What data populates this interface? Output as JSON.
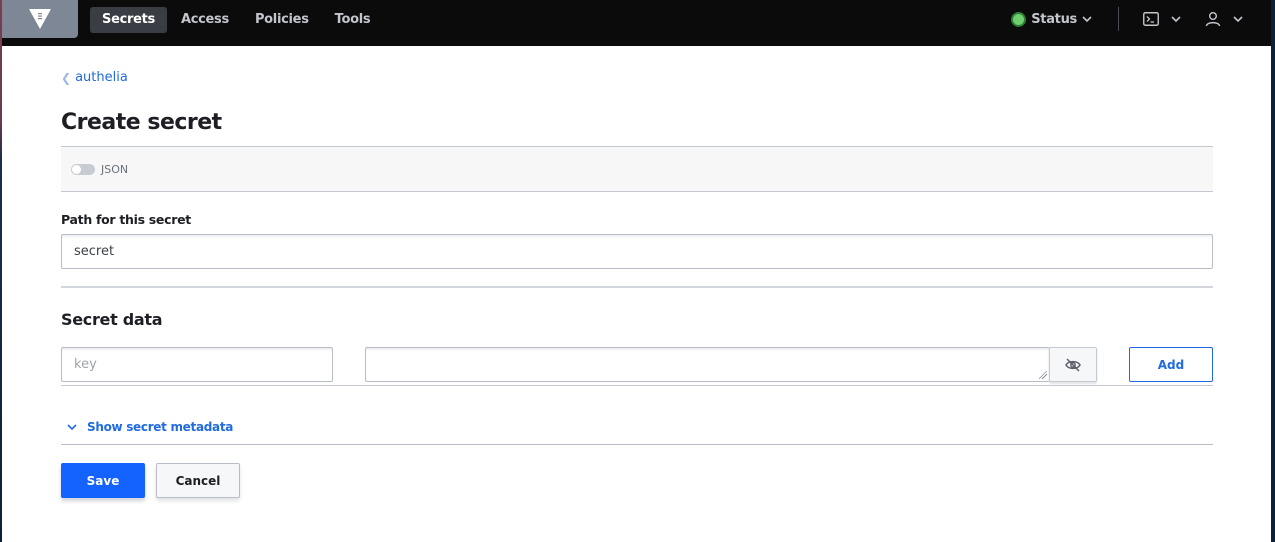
{
  "nav": {
    "logo_icon": "vault-logo-icon",
    "links": [
      {
        "label": "Secrets",
        "active": true
      },
      {
        "label": "Access",
        "active": false
      },
      {
        "label": "Policies",
        "active": false
      },
      {
        "label": "Tools",
        "active": false
      }
    ],
    "status_label": "Status",
    "status_color": "#6fcf6f",
    "console_icon": "terminal-icon",
    "user_icon": "user-icon"
  },
  "breadcrumb": {
    "label": "authelia"
  },
  "page": {
    "title": "Create secret"
  },
  "toolbar": {
    "json_toggle_label": "JSON",
    "json_toggle_on": false
  },
  "path_field": {
    "label": "Path for this secret",
    "value": "secret"
  },
  "secret_data": {
    "title": "Secret data",
    "key_placeholder": "key",
    "value": "",
    "mask_icon": "eye-off-icon",
    "add_label": "Add"
  },
  "metadata": {
    "toggle_label": "Show secret metadata"
  },
  "actions": {
    "save_label": "Save",
    "cancel_label": "Cancel"
  },
  "colors": {
    "primary": "#1563ff",
    "link": "#1f6bdf",
    "navbar": "#0b0b0c"
  }
}
